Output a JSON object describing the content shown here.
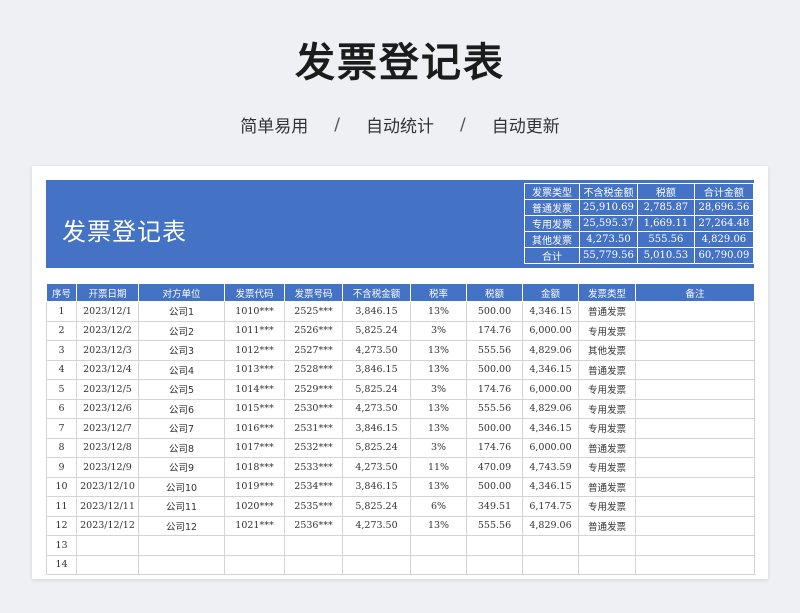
{
  "page": {
    "title": "发票登记表",
    "subtitle": [
      "简单易用",
      "自动统计",
      "自动更新"
    ],
    "separator": "/"
  },
  "banner": {
    "title": "发票登记表"
  },
  "summary": {
    "headers": [
      "发票类型",
      "不含税金额",
      "税额",
      "合计金额"
    ],
    "rows": [
      [
        "普通发票",
        "25,910.69",
        "2,785.87",
        "28,696.56"
      ],
      [
        "专用发票",
        "25,595.37",
        "1,669.11",
        "27,264.48"
      ],
      [
        "其他发票",
        "4,273.50",
        "555.56",
        "4,829.06"
      ],
      [
        "合计",
        "55,779.56",
        "5,010.53",
        "60,790.09"
      ]
    ]
  },
  "table": {
    "headers": [
      "序号",
      "开票日期",
      "对方单位",
      "发票代码",
      "发票号码",
      "不含税金额",
      "税率",
      "税额",
      "金额",
      "发票类型",
      "备注"
    ],
    "rows": [
      [
        "1",
        "2023/12/1",
        "公司1",
        "1010***",
        "2525***",
        "3,846.15",
        "13%",
        "500.00",
        "4,346.15",
        "普通发票",
        ""
      ],
      [
        "2",
        "2023/12/2",
        "公司2",
        "1011***",
        "2526***",
        "5,825.24",
        "3%",
        "174.76",
        "6,000.00",
        "专用发票",
        ""
      ],
      [
        "3",
        "2023/12/3",
        "公司3",
        "1012***",
        "2527***",
        "4,273.50",
        "13%",
        "555.56",
        "4,829.06",
        "其他发票",
        ""
      ],
      [
        "4",
        "2023/12/4",
        "公司4",
        "1013***",
        "2528***",
        "3,846.15",
        "13%",
        "500.00",
        "4,346.15",
        "普通发票",
        ""
      ],
      [
        "5",
        "2023/12/5",
        "公司5",
        "1014***",
        "2529***",
        "5,825.24",
        "3%",
        "174.76",
        "6,000.00",
        "专用发票",
        ""
      ],
      [
        "6",
        "2023/12/6",
        "公司6",
        "1015***",
        "2530***",
        "4,273.50",
        "13%",
        "555.56",
        "4,829.06",
        "专用发票",
        ""
      ],
      [
        "7",
        "2023/12/7",
        "公司7",
        "1016***",
        "2531***",
        "3,846.15",
        "13%",
        "500.00",
        "4,346.15",
        "专用发票",
        ""
      ],
      [
        "8",
        "2023/12/8",
        "公司8",
        "1017***",
        "2532***",
        "5,825.24",
        "3%",
        "174.76",
        "6,000.00",
        "普通发票",
        ""
      ],
      [
        "9",
        "2023/12/9",
        "公司9",
        "1018***",
        "2533***",
        "4,273.50",
        "11%",
        "470.09",
        "4,743.59",
        "专用发票",
        ""
      ],
      [
        "10",
        "2023/12/10",
        "公司10",
        "1019***",
        "2534***",
        "3,846.15",
        "13%",
        "500.00",
        "4,346.15",
        "普通发票",
        ""
      ],
      [
        "11",
        "2023/12/11",
        "公司11",
        "1020***",
        "2535***",
        "5,825.24",
        "6%",
        "349.51",
        "6,174.75",
        "专用发票",
        ""
      ],
      [
        "12",
        "2023/12/12",
        "公司12",
        "1021***",
        "2536***",
        "4,273.50",
        "13%",
        "555.56",
        "4,829.06",
        "普通发票",
        ""
      ],
      [
        "13",
        "",
        "",
        "",
        "",
        "",
        "",
        "",
        "",
        "",
        ""
      ],
      [
        "14",
        "",
        "",
        "",
        "",
        "",
        "",
        "",
        "",
        "",
        ""
      ]
    ]
  },
  "colors": {
    "accent": "#4472c4",
    "background": "#eef0f4",
    "text": "#333333",
    "grid_line": "#d4d4d4"
  }
}
